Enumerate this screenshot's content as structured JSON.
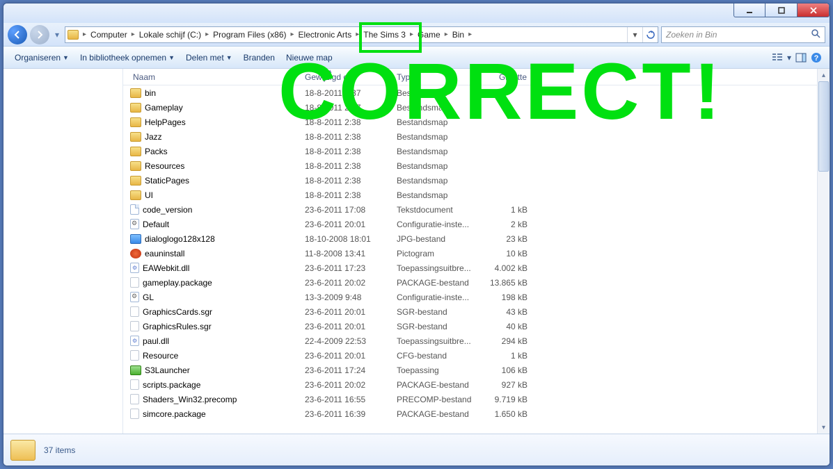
{
  "breadcrumb": [
    {
      "label": "Computer"
    },
    {
      "label": "Lokale schijf (C:)"
    },
    {
      "label": "Program Files (x86)"
    },
    {
      "label": "Electronic Arts"
    },
    {
      "label": "The Sims 3"
    },
    {
      "label": "Game"
    },
    {
      "label": "Bin"
    }
  ],
  "search": {
    "placeholder": "Zoeken in Bin"
  },
  "toolbar": {
    "organize": "Organiseren",
    "library": "In bibliotheek opnemen",
    "share": "Delen met",
    "burn": "Branden",
    "newfolder": "Nieuwe map"
  },
  "columns": {
    "name": "Naam",
    "date": "Gewijzigd op",
    "type": "Type",
    "size": "Grootte"
  },
  "rows": [
    {
      "icon": "folder",
      "name": "bin",
      "date": "18-8-2011 2:37",
      "type": "Bestandsmap",
      "size": ""
    },
    {
      "icon": "folder",
      "name": "Gameplay",
      "date": "18-8-2011 2:37",
      "type": "Bestandsmap",
      "size": ""
    },
    {
      "icon": "folder",
      "name": "HelpPages",
      "date": "18-8-2011 2:38",
      "type": "Bestandsmap",
      "size": ""
    },
    {
      "icon": "folder",
      "name": "Jazz",
      "date": "18-8-2011 2:38",
      "type": "Bestandsmap",
      "size": ""
    },
    {
      "icon": "folder",
      "name": "Packs",
      "date": "18-8-2011 2:38",
      "type": "Bestandsmap",
      "size": ""
    },
    {
      "icon": "folder",
      "name": "Resources",
      "date": "18-8-2011 2:38",
      "type": "Bestandsmap",
      "size": ""
    },
    {
      "icon": "folder",
      "name": "StaticPages",
      "date": "18-8-2011 2:38",
      "type": "Bestandsmap",
      "size": ""
    },
    {
      "icon": "folder",
      "name": "UI",
      "date": "18-8-2011 2:38",
      "type": "Bestandsmap",
      "size": ""
    },
    {
      "icon": "txt",
      "name": "code_version",
      "date": "23-6-2011 17:08",
      "type": "Tekstdocument",
      "size": "1 kB"
    },
    {
      "icon": "cfg",
      "name": "Default",
      "date": "23-6-2011 20:01",
      "type": "Configuratie-inste...",
      "size": "2 kB"
    },
    {
      "icon": "jpg",
      "name": "dialoglogo128x128",
      "date": "18-10-2008 18:01",
      "type": "JPG-bestand",
      "size": "23 kB"
    },
    {
      "icon": "ico",
      "name": "eauninstall",
      "date": "11-8-2008 13:41",
      "type": "Pictogram",
      "size": "10 kB"
    },
    {
      "icon": "dll",
      "name": "EAWebkit.dll",
      "date": "23-6-2011 17:23",
      "type": "Toepassingsuitbre...",
      "size": "4.002 kB"
    },
    {
      "icon": "generic",
      "name": "gameplay.package",
      "date": "23-6-2011 20:02",
      "type": "PACKAGE-bestand",
      "size": "13.865 kB"
    },
    {
      "icon": "cfg",
      "name": "GL",
      "date": "13-3-2009 9:48",
      "type": "Configuratie-inste...",
      "size": "198 kB"
    },
    {
      "icon": "generic",
      "name": "GraphicsCards.sgr",
      "date": "23-6-2011 20:01",
      "type": "SGR-bestand",
      "size": "43 kB"
    },
    {
      "icon": "generic",
      "name": "GraphicsRules.sgr",
      "date": "23-6-2011 20:01",
      "type": "SGR-bestand",
      "size": "40 kB"
    },
    {
      "icon": "dll",
      "name": "paul.dll",
      "date": "22-4-2009 22:53",
      "type": "Toepassingsuitbre...",
      "size": "294 kB"
    },
    {
      "icon": "generic",
      "name": "Resource",
      "date": "23-6-2011 20:01",
      "type": "CFG-bestand",
      "size": "1 kB"
    },
    {
      "icon": "exe",
      "name": "S3Launcher",
      "date": "23-6-2011 17:24",
      "type": "Toepassing",
      "size": "106 kB"
    },
    {
      "icon": "generic",
      "name": "scripts.package",
      "date": "23-6-2011 20:02",
      "type": "PACKAGE-bestand",
      "size": "927 kB"
    },
    {
      "icon": "generic",
      "name": "Shaders_Win32.precomp",
      "date": "23-6-2011 16:55",
      "type": "PRECOMP-bestand",
      "size": "9.719 kB"
    },
    {
      "icon": "generic",
      "name": "simcore.package",
      "date": "23-6-2011 16:39",
      "type": "PACKAGE-bestand",
      "size": "1.650 kB"
    }
  ],
  "status": {
    "items": "37 items"
  },
  "overlay": {
    "text": "CORRECT!"
  }
}
